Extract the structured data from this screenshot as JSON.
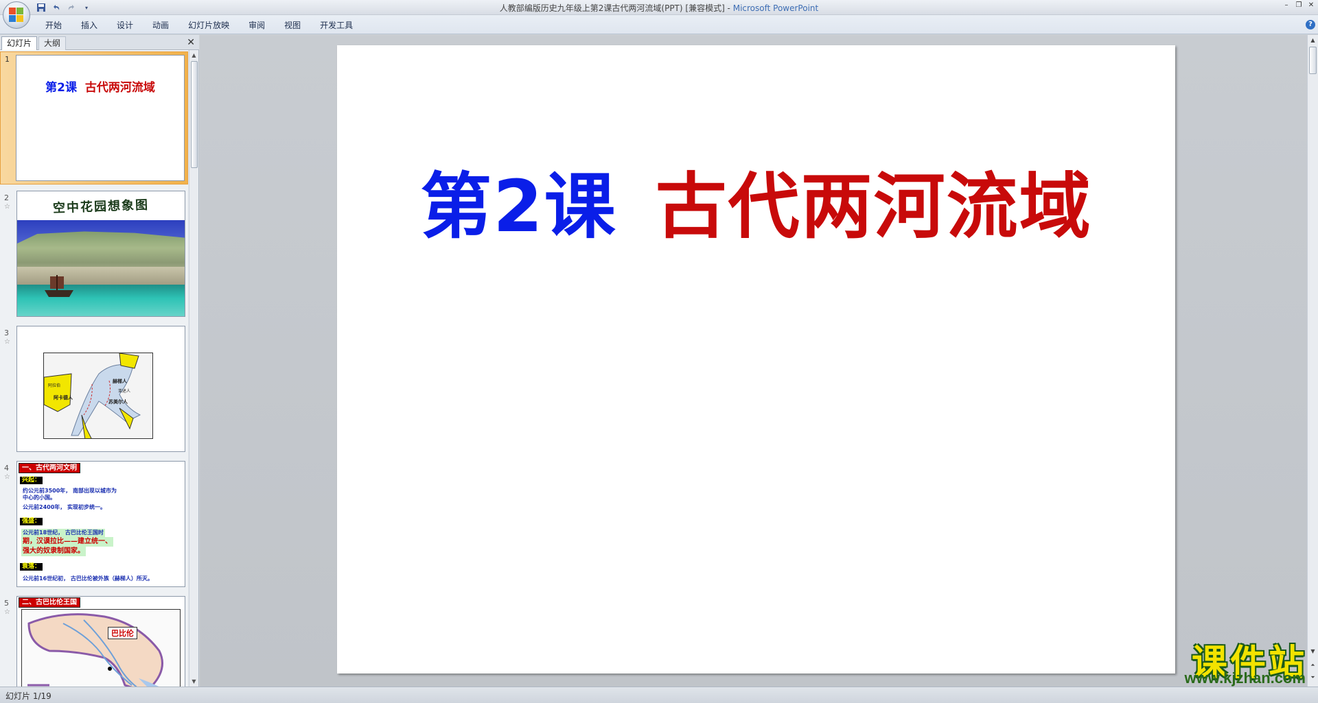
{
  "window": {
    "title_doc": "人教部编版历史九年级上第2课古代两河流域(PPT) [兼容模式] - ",
    "title_app": "Microsoft PowerPoint"
  },
  "ribbon": {
    "tabs": [
      "开始",
      "插入",
      "设计",
      "动画",
      "幻灯片放映",
      "审阅",
      "视图",
      "开发工具"
    ]
  },
  "left_panel": {
    "tabs": [
      "幻灯片",
      "大纲"
    ],
    "thumbnails": [
      {
        "num": "1",
        "title_a": "第2课",
        "title_b": "古代两河流域"
      },
      {
        "num": "2",
        "title": "空中花园想象图"
      },
      {
        "num": "3",
        "labels": [
          "阿卡德人",
          "赫梯人",
          "亚述人",
          "苏美尔人",
          "阿拉伯"
        ]
      },
      {
        "num": "4",
        "heading": "一、古代两河文明",
        "tag_rise": "兴起：",
        "line1": "约公元前3500年， 南部出现以城市为",
        "line1b": "中心的小国。",
        "line2": "公元前2400年， 实现初步统一。",
        "tag_strong": "强盛：",
        "line3": "公元前18世纪， 古巴比伦王国时",
        "line3b": "期，汉谟拉比——建立统一、",
        "line3c": "强大的奴隶制国家。",
        "tag_decline": "衰落：",
        "line4": "公元前16世纪初， 古巴比伦被外族（赫梯人）所灭。"
      },
      {
        "num": "5",
        "heading": "二、古巴比伦王国",
        "map_label": "巴比伦"
      }
    ]
  },
  "slide": {
    "title_a": "第2课",
    "title_b": "古代两河流域"
  },
  "status": {
    "slide_counter": "幻灯片 1/19"
  },
  "watermark": {
    "text": "课件站",
    "url": "www.kjzhan.com"
  },
  "colors": {
    "title_blue": "#0a1ee8",
    "title_red": "#c80a0a",
    "selection_orange": "#f2b24a"
  }
}
